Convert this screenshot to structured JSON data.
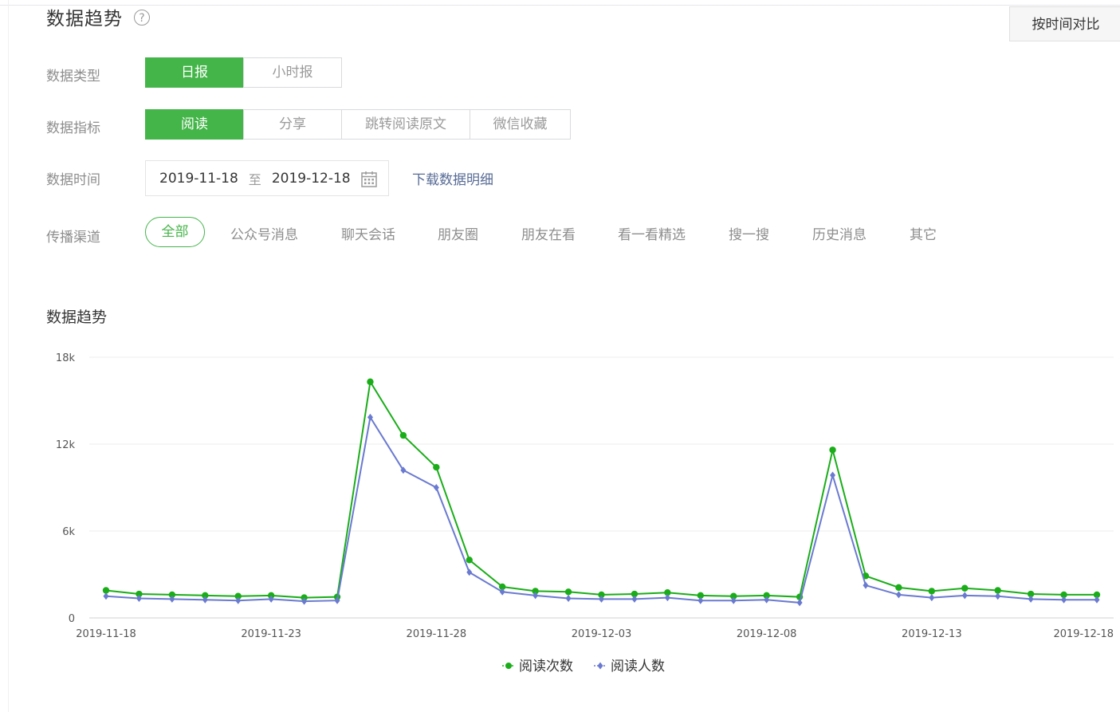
{
  "header": {
    "title": "数据趋势",
    "help_icon": "?",
    "compare_button": "按时间对比"
  },
  "filters": {
    "data_type": {
      "label": "数据类型",
      "options": [
        "日报",
        "小时报"
      ],
      "selected": "日报"
    },
    "metric": {
      "label": "数据指标",
      "options": [
        "阅读",
        "分享",
        "跳转阅读原文",
        "微信收藏"
      ],
      "selected": "阅读"
    },
    "time": {
      "label": "数据时间",
      "start": "2019-11-18",
      "to": "至",
      "end": "2019-12-18",
      "download_link": "下载数据明细"
    },
    "channel": {
      "label": "传播渠道",
      "options": [
        "全部",
        "公众号消息",
        "聊天会话",
        "朋友圈",
        "朋友在看",
        "看一看精选",
        "搜一搜",
        "历史消息",
        "其它"
      ],
      "selected": "全部"
    }
  },
  "chart_title": "数据趋势",
  "colors": {
    "accent": "#44b549",
    "series1": "#1aad19",
    "series2": "#6a7ad0",
    "link": "#576b95"
  },
  "chart_data": {
    "type": "line",
    "x": [
      "2019-11-18",
      "2019-11-19",
      "2019-11-20",
      "2019-11-21",
      "2019-11-22",
      "2019-11-23",
      "2019-11-24",
      "2019-11-25",
      "2019-11-26",
      "2019-11-27",
      "2019-11-28",
      "2019-11-29",
      "2019-11-30",
      "2019-12-01",
      "2019-12-02",
      "2019-12-03",
      "2019-12-04",
      "2019-12-05",
      "2019-12-06",
      "2019-12-07",
      "2019-12-08",
      "2019-12-09",
      "2019-12-10",
      "2019-12-11",
      "2019-12-12",
      "2019-12-13",
      "2019-12-14",
      "2019-12-15",
      "2019-12-16",
      "2019-12-17",
      "2019-12-18"
    ],
    "xticks": [
      "2019-11-18",
      "2019-11-23",
      "2019-11-28",
      "2019-12-03",
      "2019-12-08",
      "2019-12-13",
      "2019-12-18"
    ],
    "yticks": [
      "0",
      "6k",
      "12k",
      "18k"
    ],
    "ylim": [
      0,
      18000
    ],
    "grid": true,
    "legend_position": "bottom-center",
    "series": [
      {
        "name": "阅读次数",
        "color": "#1aad19",
        "marker": "circle",
        "values": [
          1900,
          1650,
          1600,
          1550,
          1500,
          1550,
          1400,
          1450,
          16300,
          12600,
          10400,
          4000,
          2150,
          1850,
          1800,
          1600,
          1650,
          1750,
          1550,
          1500,
          1550,
          1450,
          11600,
          2900,
          2100,
          1850,
          2050,
          1900,
          1650,
          1600,
          1600
        ]
      },
      {
        "name": "阅读人数",
        "color": "#6a7ad0",
        "marker": "diamond",
        "values": [
          1500,
          1350,
          1300,
          1250,
          1200,
          1300,
          1150,
          1200,
          13850,
          10200,
          9000,
          3150,
          1800,
          1550,
          1350,
          1300,
          1300,
          1400,
          1200,
          1200,
          1250,
          1050,
          9850,
          2250,
          1600,
          1400,
          1550,
          1500,
          1300,
          1250,
          1250
        ]
      }
    ]
  }
}
